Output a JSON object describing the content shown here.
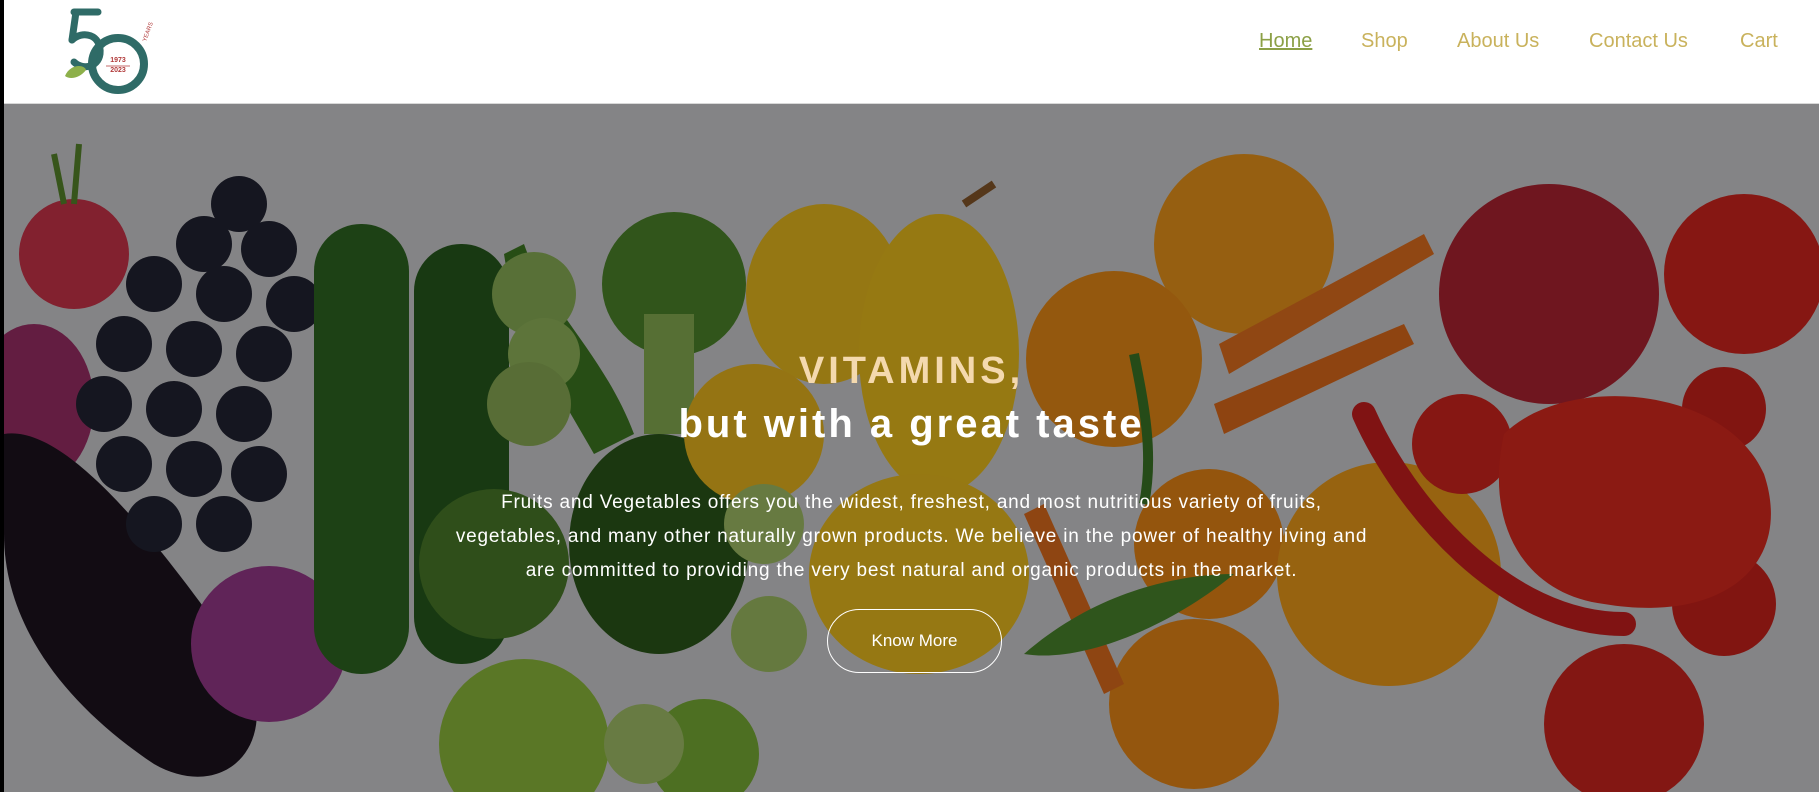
{
  "brand": {
    "logo_text": "50",
    "logo_sub": "1973 2023",
    "logo_word": "YEARS"
  },
  "nav": {
    "items": [
      {
        "label": "Home",
        "active": true
      },
      {
        "label": "Shop",
        "active": false
      },
      {
        "label": "About Us",
        "active": false
      },
      {
        "label": "Contact Us",
        "active": false
      },
      {
        "label": "Cart",
        "active": false
      }
    ]
  },
  "hero": {
    "title_line1": "VITAMINS,",
    "title_line2": "but with a great taste",
    "description": "Fruits and Vegetables offers you the widest, freshest, and most nutritious variety of fruits, vegetables, and many other naturally grown products. We believe in the power of healthy living and are committed to providing the very best natural and organic products in the market.",
    "button_label": "Know More",
    "background_image": "assorted-fruits-and-vegetables"
  },
  "colors": {
    "nav_link": "#c9b25c",
    "nav_active": "#8ca046",
    "logo_teal": "#2f6b67",
    "logo_leaf": "#8db04a",
    "headline_accent": "#f4d9ae"
  }
}
